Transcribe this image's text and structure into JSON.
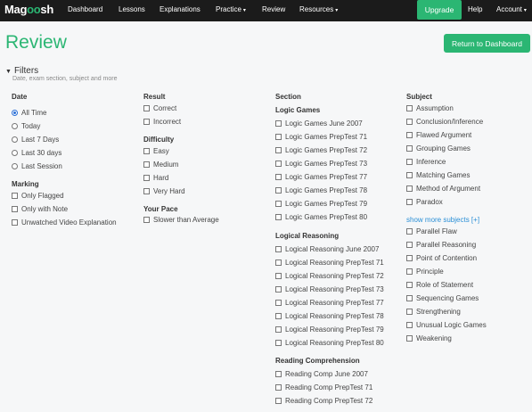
{
  "nav": {
    "logo_a": "Mag",
    "logo_o": "oo",
    "logo_b": "sh",
    "items": [
      "Dashboard",
      "Lessons",
      "Explanations",
      "Practice",
      "Review",
      "Resources"
    ],
    "upgrade": "Upgrade",
    "help": "Help",
    "account": "Account",
    "caret": "▾"
  },
  "page": {
    "title": "Review",
    "dashboard_button": "Return to Dashboard"
  },
  "filters": {
    "title": "Filters",
    "subtitle": "Date, exam section, subject and more",
    "date": {
      "heading": "Date",
      "options": [
        "All Time",
        "Today",
        "Last 7 Days",
        "Last 30 days",
        "Last Session"
      ],
      "selected": "All Time"
    },
    "marking": {
      "heading": "Marking",
      "options": [
        "Only Flagged",
        "Only with Note",
        "Unwatched Video Explanation"
      ]
    },
    "result": {
      "heading": "Result",
      "options": [
        "Correct",
        "Incorrect"
      ]
    },
    "difficulty": {
      "heading": "Difficulty",
      "options": [
        "Easy",
        "Medium",
        "Hard",
        "Very Hard"
      ]
    },
    "pace": {
      "heading": "Your Pace",
      "options": [
        "Slower than Average"
      ]
    },
    "section": {
      "heading": "Section",
      "logic_games": {
        "heading": "Logic Games",
        "options": [
          "Logic Games June 2007",
          "Logic Games PrepTest 71",
          "Logic Games PrepTest 72",
          "Logic Games PrepTest 73",
          "Logic Games PrepTest 77",
          "Logic Games PrepTest 78",
          "Logic Games PrepTest 79",
          "Logic Games PrepTest 80"
        ]
      },
      "logical_reasoning": {
        "heading": "Logical Reasoning",
        "options": [
          "Logical Reasoning June 2007",
          "Logical Reasoning PrepTest 71",
          "Logical Reasoning PrepTest 72",
          "Logical Reasoning PrepTest 73",
          "Logical Reasoning PrepTest 77",
          "Logical Reasoning PrepTest 78",
          "Logical Reasoning PrepTest 79",
          "Logical Reasoning PrepTest 80"
        ]
      },
      "reading_comp": {
        "heading": "Reading Comprehension",
        "options": [
          "Reading Comp June 2007",
          "Reading Comp PrepTest 71",
          "Reading Comp PrepTest 72"
        ]
      }
    },
    "subject": {
      "heading": "Subject",
      "options_top": [
        "Assumption",
        "Conclusion/Inference",
        "Flawed Argument",
        "Grouping Games",
        "Inference",
        "Matching Games",
        "Method of Argument",
        "Paradox"
      ],
      "show_more": "show more subjects [+]",
      "options_bottom": [
        "Parallel Flaw",
        "Parallel Reasoning",
        "Point of Contention",
        "Principle",
        "Role of Statement",
        "Sequencing Games",
        "Strengthening",
        "Unusual Logic Games",
        "Weakening"
      ]
    }
  },
  "colors": {
    "brand_green": "#2bb673",
    "navbar": "#1b1b1b",
    "link_blue": "#2a8fd6"
  }
}
